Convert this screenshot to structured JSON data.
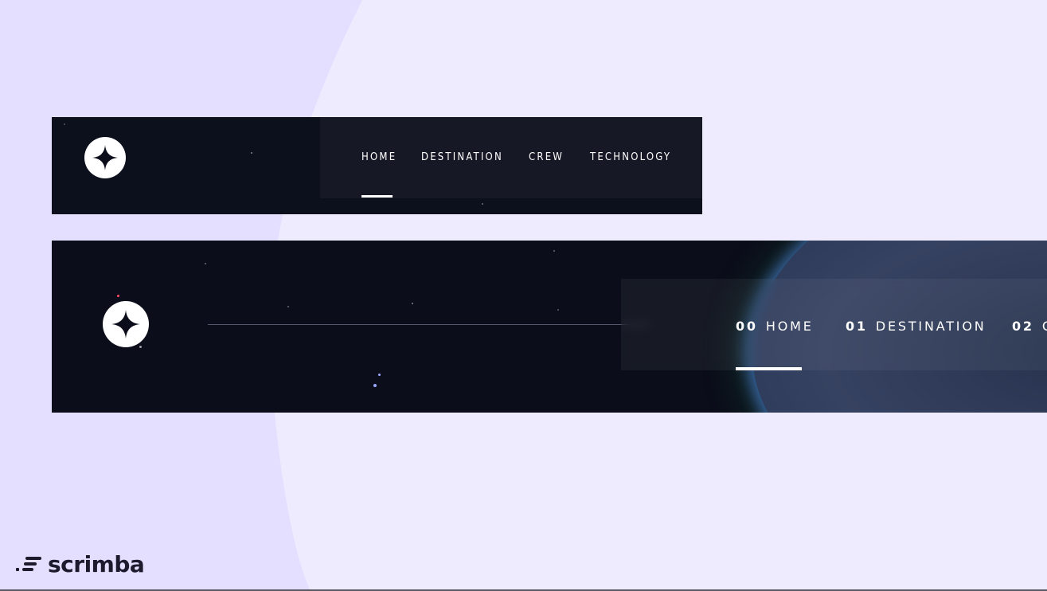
{
  "navbar_tablet": {
    "links": [
      {
        "label": "HOME"
      },
      {
        "label": "DESTINATION"
      },
      {
        "label": "CREW"
      },
      {
        "label": "TECHNOLOGY"
      }
    ],
    "logo_icon": "star-logo-icon"
  },
  "navbar_desktop": {
    "links": [
      {
        "num": "00",
        "label": "HOME"
      },
      {
        "num": "01",
        "label": "DESTINATION"
      },
      {
        "num": "02",
        "label": "C"
      }
    ],
    "logo_icon": "star-logo-icon"
  },
  "brand": {
    "name": "scrimba"
  },
  "colors": {
    "page_bg": "#eeebff",
    "page_curve": "#e4deff",
    "navbar_bg": "#0b0e1a",
    "text": "#ffffff"
  }
}
